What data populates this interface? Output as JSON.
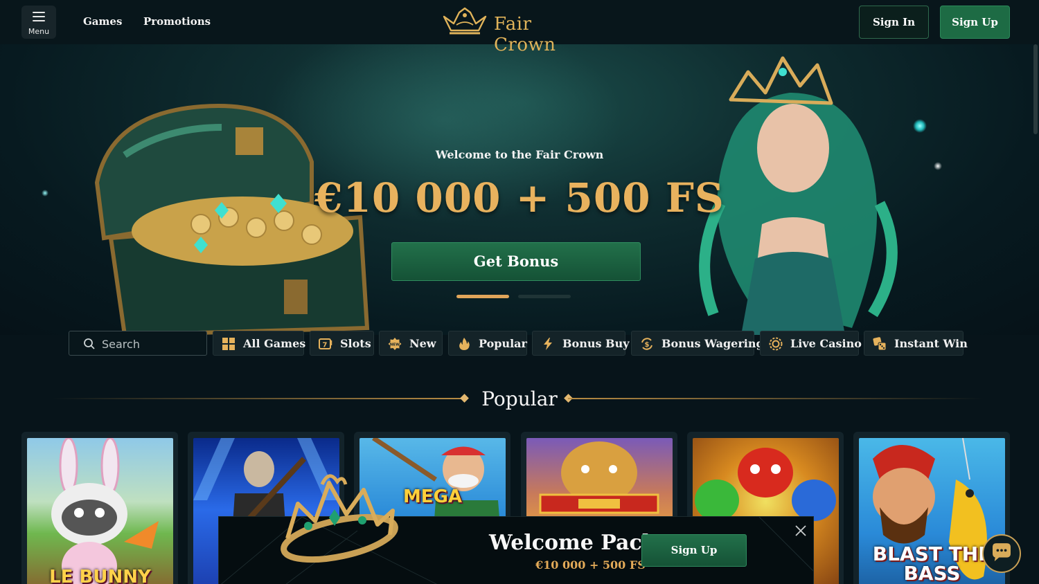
{
  "header": {
    "menu_label": "Menu",
    "nav": [
      "Games",
      "Promotions"
    ],
    "brand": "Fair Crown",
    "sign_in": "Sign In",
    "sign_up": "Sign Up"
  },
  "hero": {
    "subtitle": "Welcome to the Fair Crown",
    "title": "€10 000 + 500 FS",
    "cta": "Get Bonus",
    "slides_total": 2,
    "active_slide": 1
  },
  "search": {
    "placeholder": "Search"
  },
  "categories": [
    {
      "label": "All Games",
      "icon": "grid-icon"
    },
    {
      "label": "Slots",
      "icon": "slot-machine-icon"
    },
    {
      "label": "New",
      "icon": "new-badge-icon"
    },
    {
      "label": "Popular",
      "icon": "flame-icon"
    },
    {
      "label": "Bonus Buy",
      "icon": "lightning-icon"
    },
    {
      "label": "Bonus Wagering",
      "icon": "dollar-cycle-icon"
    },
    {
      "label": "Live Casino",
      "icon": "chip-icon"
    },
    {
      "label": "Instant Win",
      "icon": "dice-icon"
    }
  ],
  "section": {
    "title": "Popular"
  },
  "games": [
    {
      "title": "LE BUNNY"
    },
    {
      "title": ""
    },
    {
      "title": "MEGA"
    },
    {
      "title": ""
    },
    {
      "title": ""
    },
    {
      "title": "BLAST THE BASS"
    }
  ],
  "popup": {
    "title": "Welcome Pack",
    "amount": "€10 000 + 500 FS",
    "cta": "Sign Up"
  },
  "colors": {
    "accent_gold": "#e0b35a",
    "primary_green": "#1d6b44",
    "background": "#07141a"
  }
}
